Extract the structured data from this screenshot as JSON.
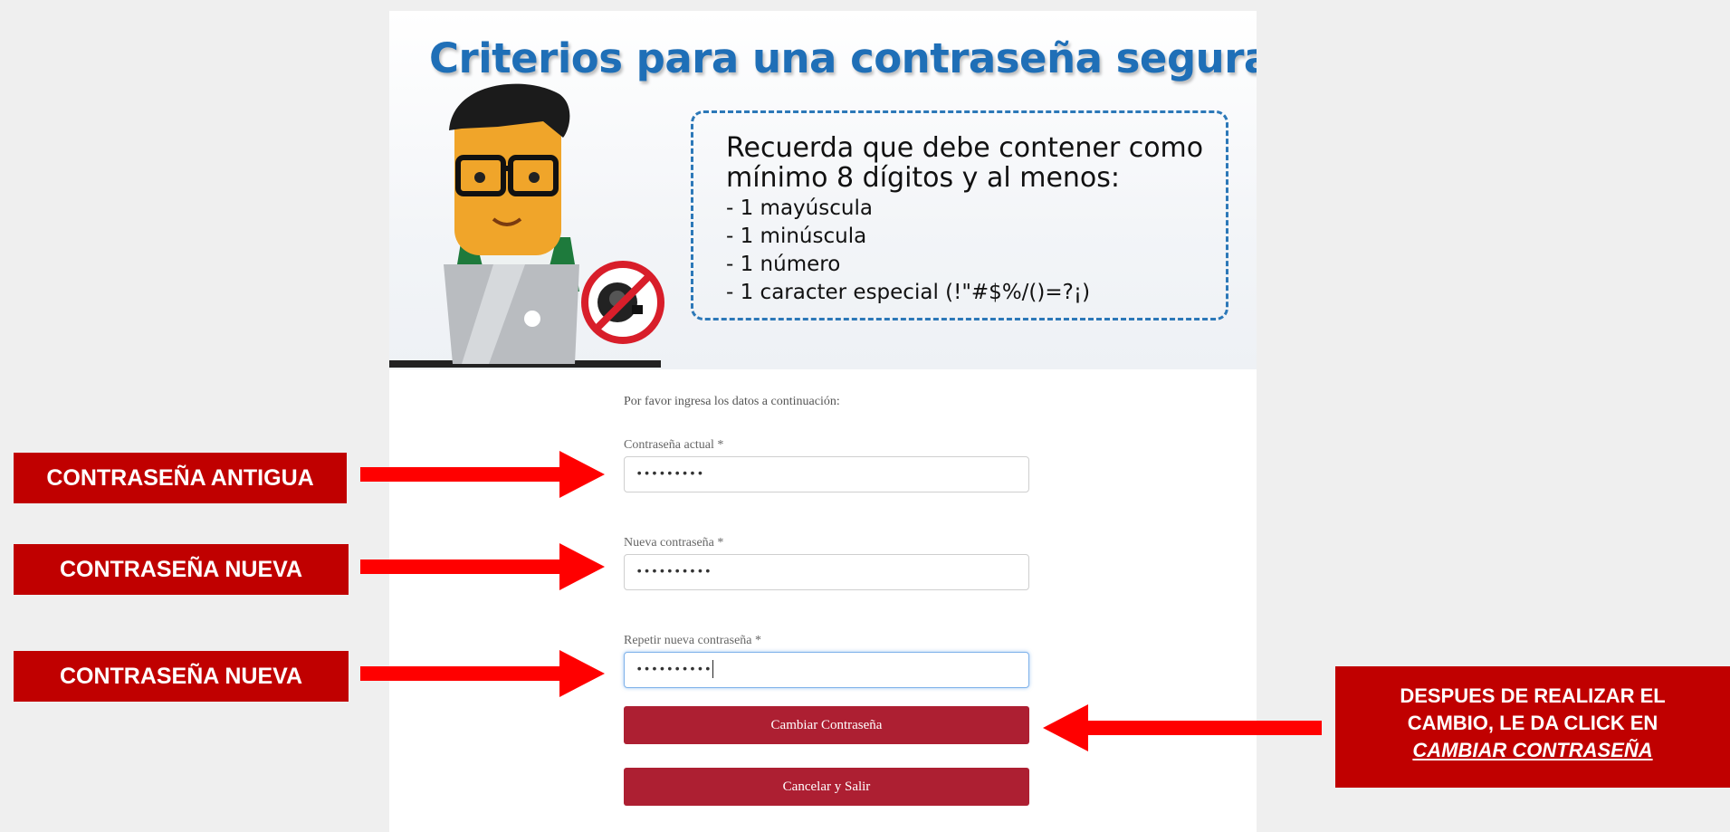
{
  "banner": {
    "title": "Criterios para una contraseña segura",
    "heading": "Recuerda que debe contener como mínimo 8 dígitos y al menos:",
    "requirements": [
      "- 1 mayúscula",
      "- 1 minúscula",
      "- 1 número",
      "- 1 caracter especial (!\"#$%/()=?¡)"
    ]
  },
  "form": {
    "intro": "Por favor ingresa los datos a continuación:",
    "current_password": {
      "label": "Contraseña actual *",
      "value": "•••••••••"
    },
    "new_password": {
      "label": "Nueva contraseña *",
      "value": "••••••••••"
    },
    "repeat_password": {
      "label": "Repetir nueva contraseña *",
      "value": "••••••••••"
    },
    "change_button": "Cambiar Contraseña",
    "cancel_button": "Cancelar y Salir"
  },
  "annotations": {
    "old_password": "CONTRASEÑA ANTIGUA",
    "new_password_1": "CONTRASEÑA NUEVA",
    "new_password_2": "CONTRASEÑA NUEVA",
    "after_change_line1": "DESPUES DE REALIZAR EL",
    "after_change_line2": "CAMBIO, LE DA CLICK EN",
    "after_change_emphasis": "CAMBIAR CONTRASEÑA"
  },
  "colors": {
    "title_blue": "#1f6fb7",
    "button_red": "#ad1f32",
    "callout_red": "#c00000",
    "arrow_red": "#ff0000"
  }
}
